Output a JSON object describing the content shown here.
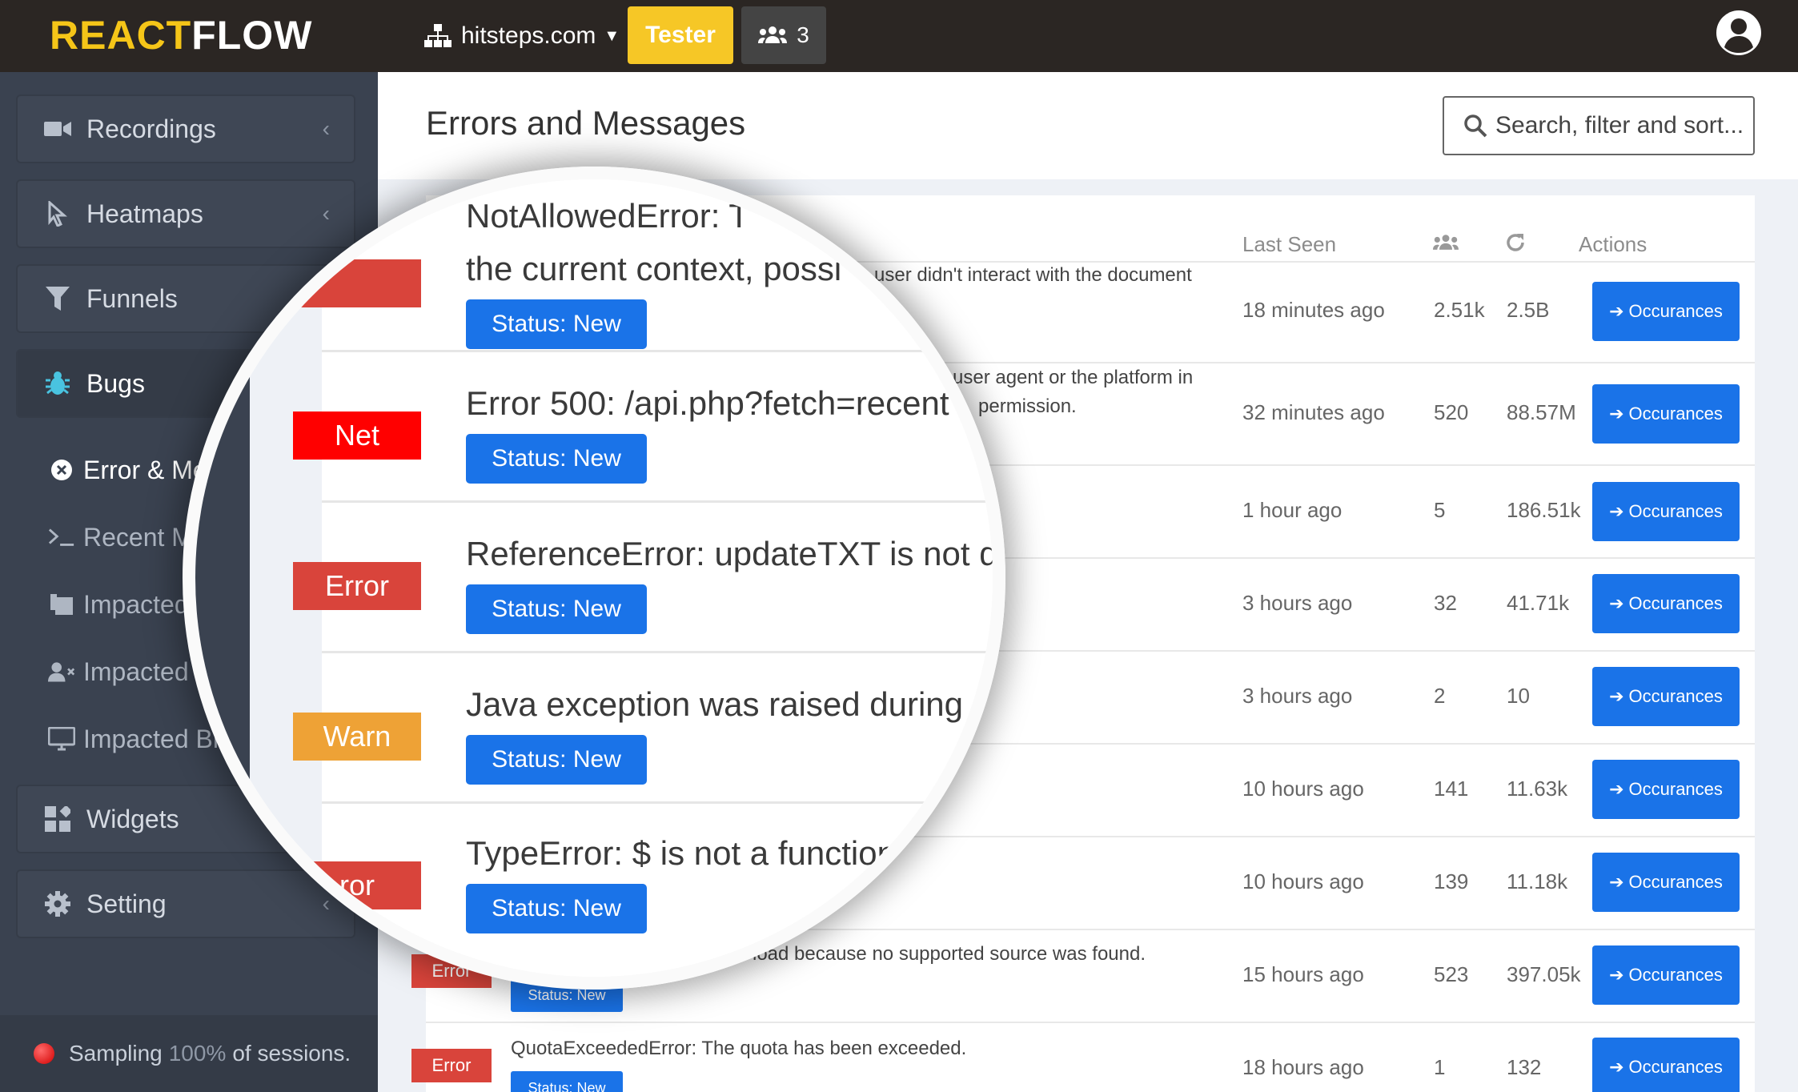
{
  "topbar": {
    "logo_react": "REACT",
    "logo_flow": "FLOW",
    "site": "hitsteps.com",
    "tester_label": "Tester",
    "users_count": "3",
    "colors": {
      "bar": "#2b2623",
      "logo_accent": "#f5c518",
      "tester": "#f6c726"
    }
  },
  "sidebar": {
    "items": [
      {
        "label": "Recordings",
        "icon": "video-camera-icon"
      },
      {
        "label": "Heatmaps",
        "icon": "cursor-icon"
      },
      {
        "label": "Funnels",
        "icon": "funnel-icon"
      },
      {
        "label": "Bugs",
        "icon": "bug-icon"
      },
      {
        "label": "Widgets",
        "icon": "widgets-icon"
      },
      {
        "label": "Setting",
        "icon": "gear-icon"
      }
    ],
    "sub_items": [
      {
        "label": "Error & Me",
        "icon": "circle-x-icon"
      },
      {
        "label": "Recent M",
        "icon": "terminal-icon"
      },
      {
        "label": "Impacted",
        "icon": "pages-icon"
      },
      {
        "label": "Impacted",
        "icon": "user-x-icon"
      },
      {
        "label": "Impacted Br",
        "icon": "monitor-icon"
      }
    ],
    "sampling": {
      "label": "Sampling",
      "percent": "100%",
      "suffix": "of sessions."
    }
  },
  "main": {
    "title": "Errors and Messages",
    "search_placeholder": "Search, filter and sort...",
    "columns": {
      "last_seen": "Last Seen",
      "users_icon": "users-icon",
      "reload_icon": "reload-icon",
      "actions": "Actions"
    },
    "action_label": "Occurances",
    "rows": [
      {
        "last_seen": "18 minutes ago",
        "users": "2.51k",
        "count": "2.5B",
        "msg_frag": "user didn't interact with the document"
      },
      {
        "last_seen": "32 minutes ago",
        "users": "520",
        "count": "88.57M",
        "msg_frag": "user agent or the platform in",
        "msg_frag2": "permission."
      },
      {
        "last_seen": "1 hour ago",
        "users": "5",
        "count": "186.51k"
      },
      {
        "last_seen": "3 hours ago",
        "users": "32",
        "count": "41.71k"
      },
      {
        "last_seen": "3 hours ago",
        "users": "2",
        "count": "10"
      },
      {
        "last_seen": "10 hours ago",
        "users": "141",
        "count": "11.63k"
      },
      {
        "last_seen": "10 hours ago",
        "users": "139",
        "count": "11.18k"
      },
      {
        "last_seen": "15 hours ago",
        "users": "523",
        "count": "397.05k",
        "badge": "Error",
        "msg_frag": "load because no supported source was found.",
        "status": "Status: New"
      },
      {
        "last_seen": "18 hours ago",
        "users": "1",
        "count": "132",
        "badge": "Error",
        "msg_frag": "QuotaExceededError: The quota has been exceeded.",
        "status": "Status: New"
      }
    ]
  },
  "magnifier": {
    "rows": [
      {
        "badge": "",
        "msg_top": "NotAllowedError: T",
        "msg": "the current context, possi",
        "status": "Status: New"
      },
      {
        "badge": "Net",
        "badge_color": "#ff0000",
        "msg": "Error 500: /api.php?fetch=recent",
        "status": "Status: New"
      },
      {
        "badge": "Error",
        "badge_color": "#d9443b",
        "msg": "ReferenceError: updateTXT is not defi",
        "status": "Status: New"
      },
      {
        "badge": "Warn",
        "badge_color": "#eea236",
        "msg": "Java exception was raised during me",
        "status": "Status: New"
      },
      {
        "badge": "ror",
        "badge_color": "#d9443b",
        "msg": "TypeError: $ is not a function",
        "status": "Status: New"
      }
    ]
  }
}
